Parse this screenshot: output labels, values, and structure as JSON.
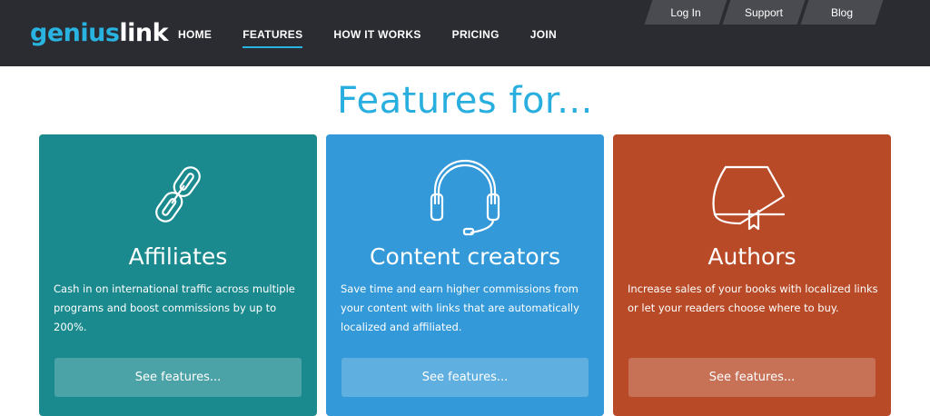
{
  "header": {
    "logo": {
      "part1": "geni",
      "part2": "us",
      "part3": "link"
    },
    "nav": [
      {
        "label": "HOME",
        "active": false
      },
      {
        "label": "FEATURES",
        "active": true
      },
      {
        "label": "HOW IT WORKS",
        "active": false
      },
      {
        "label": "PRICING",
        "active": false
      },
      {
        "label": "JOIN",
        "active": false
      }
    ],
    "utility": [
      {
        "label": "Log In"
      },
      {
        "label": "Support"
      },
      {
        "label": "Blog"
      }
    ]
  },
  "main": {
    "heading": "Features for...",
    "cards": [
      {
        "title": "Affiliates",
        "description": "Cash in on international traffic across multiple programs and boost commissions by up to 200%.",
        "button": "See features...",
        "icon": "chain-link-icon",
        "color": "#1a8a8f"
      },
      {
        "title": "Content creators",
        "description": "Save time and earn higher commissions from your content with links that are automatically localized and affiliated.",
        "button": "See features...",
        "icon": "headset-icon",
        "color": "#3399d8"
      },
      {
        "title": "Authors",
        "description": "Increase sales of your books with localized links or let your readers choose where to buy.",
        "button": "See features...",
        "icon": "book-icon",
        "color": "#b84a27"
      }
    ]
  },
  "colors": {
    "topbar": "#2b2c31",
    "accent": "#29aee0"
  }
}
